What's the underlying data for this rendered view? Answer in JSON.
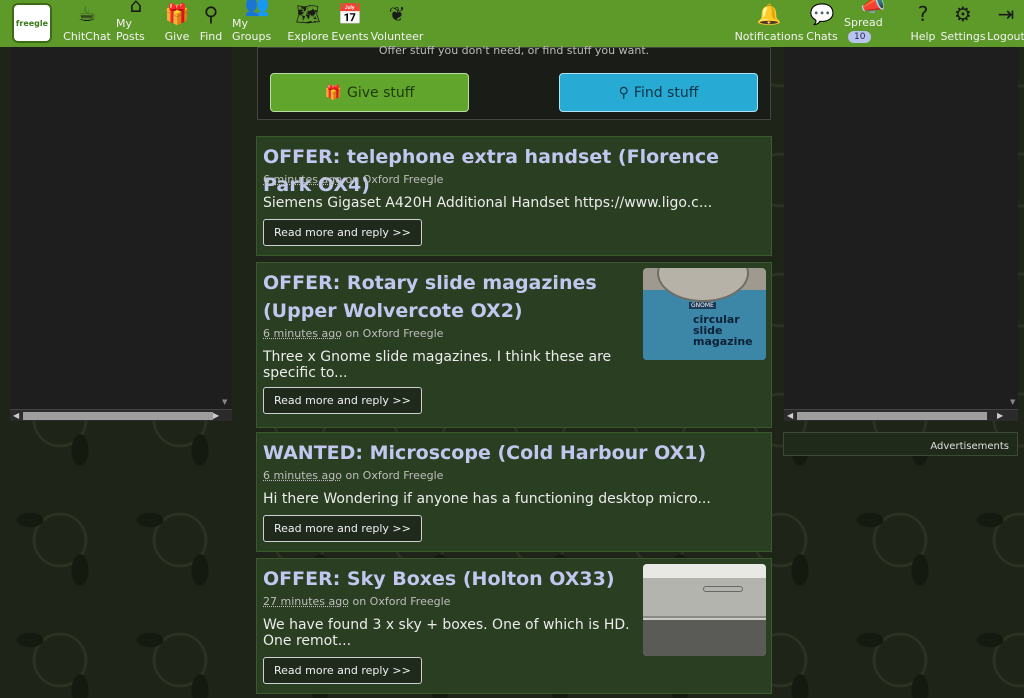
{
  "nav": {
    "logo_text": "freegle",
    "items": [
      {
        "label": "ChitChat",
        "icon": "☕"
      },
      {
        "label": "My Posts",
        "icon": "⌂"
      },
      {
        "label": "Give",
        "icon": "🎁"
      },
      {
        "label": "Find",
        "icon": "⚲"
      },
      {
        "label": "My Groups",
        "icon": "👥"
      },
      {
        "label": "Explore",
        "icon": "🗺"
      },
      {
        "label": "Events",
        "icon": "📅"
      },
      {
        "label": "Volunteer",
        "icon": "❦"
      }
    ],
    "right_items": [
      {
        "label": "Notifications",
        "icon": "🔔"
      },
      {
        "label": "Chats",
        "icon": "💬"
      },
      {
        "label": "Spread",
        "icon": "📣",
        "badge": "10"
      },
      {
        "label": "Help",
        "icon": "?"
      },
      {
        "label": "Settings",
        "icon": "⚙"
      },
      {
        "label": "Logout",
        "icon": "⇥"
      }
    ]
  },
  "compose": {
    "subtitle": "Offer stuff you don't need, or find stuff you want.",
    "give_label": "Give stuff",
    "find_label": "Find stuff"
  },
  "ads_label": "Advertisements",
  "posts": [
    {
      "title": "OFFER: telephone extra handset (Florence Park OX4)",
      "ago": "6 minutes ago",
      "group": "on Oxford Freegle",
      "desc": "Siemens Gigaset A420H Additional Handset https://www.ligo.c...",
      "read": "Read more and reply >>"
    },
    {
      "title": "OFFER: Rotary slide magazines (Upper Wolvercote OX2)",
      "ago": "6 minutes ago",
      "group": "on Oxford Freegle",
      "desc": "Three x Gnome slide magazines. I think these are specific to...",
      "read": "Read more and reply >>",
      "image_text": "circular slide magazine",
      "image_brand": "GNOME"
    },
    {
      "title": "WANTED: Microscope (Cold Harbour OX1)",
      "ago": "6 minutes ago",
      "group": "on Oxford Freegle",
      "desc": "Hi there Wondering if anyone has a functioning desktop micro...",
      "read": "Read more and reply >>"
    },
    {
      "title": "OFFER: Sky Boxes (Holton OX33)",
      "ago": "27 minutes ago",
      "group": "on Oxford Freegle",
      "desc": "We have found 3 x sky + boxes. One of which is HD. One remot...",
      "read": "Read more and reply >>"
    }
  ]
}
